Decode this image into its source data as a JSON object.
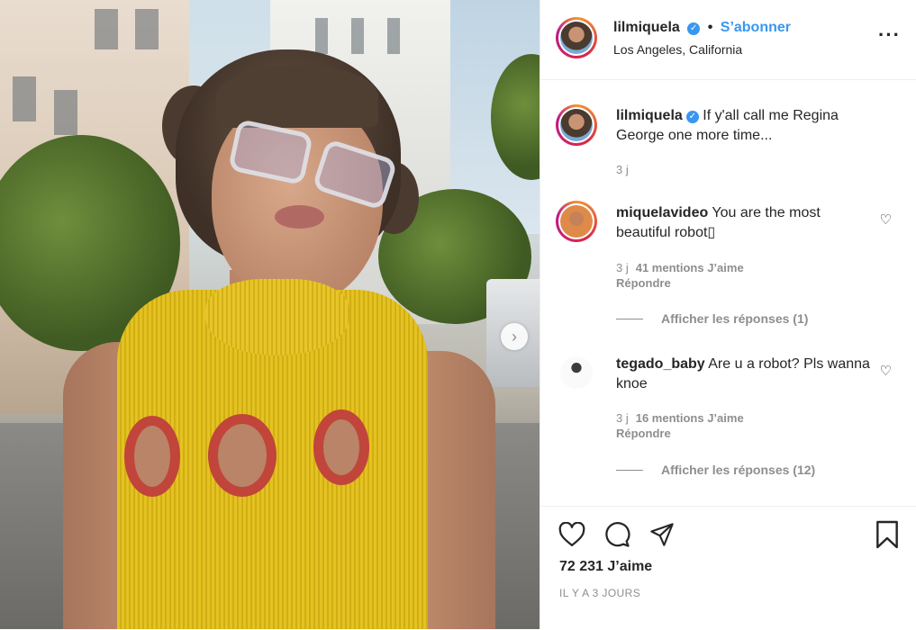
{
  "post": {
    "username": "lilmiquela",
    "follow_label": "S’abonner",
    "separator": "•",
    "location": "Los Angeles, California",
    "more_icon": "more-horizontal-icon",
    "verified_icon": "verified-badge-icon"
  },
  "caption": {
    "username": "lilmiquela",
    "text": "If y'all call me Regina George one more time...",
    "time": "3 j"
  },
  "comments": [
    {
      "username": "miquelavideo",
      "text": "You are the most beautiful robot▯",
      "time": "3 j",
      "likes": "41 mentions J’aime",
      "reply_label": "Répondre",
      "view_replies": "Afficher les réponses (1)"
    },
    {
      "username": "tegado_baby",
      "text": "Are u a robot? Pls wanna knoe",
      "time": "3 j",
      "likes": "16 mentions J’aime",
      "reply_label": "Répondre",
      "view_replies": "Afficher les réponses (12)"
    }
  ],
  "footer": {
    "likes": "72 231 J’aime",
    "age": "IL Y A 3 JOURS",
    "icons": [
      "heart-icon",
      "comment-icon",
      "share-icon",
      "bookmark-icon"
    ]
  },
  "colors": {
    "accent": "#3897f0",
    "text": "#262626",
    "muted": "#8e8e8e",
    "border": "#efefef"
  }
}
